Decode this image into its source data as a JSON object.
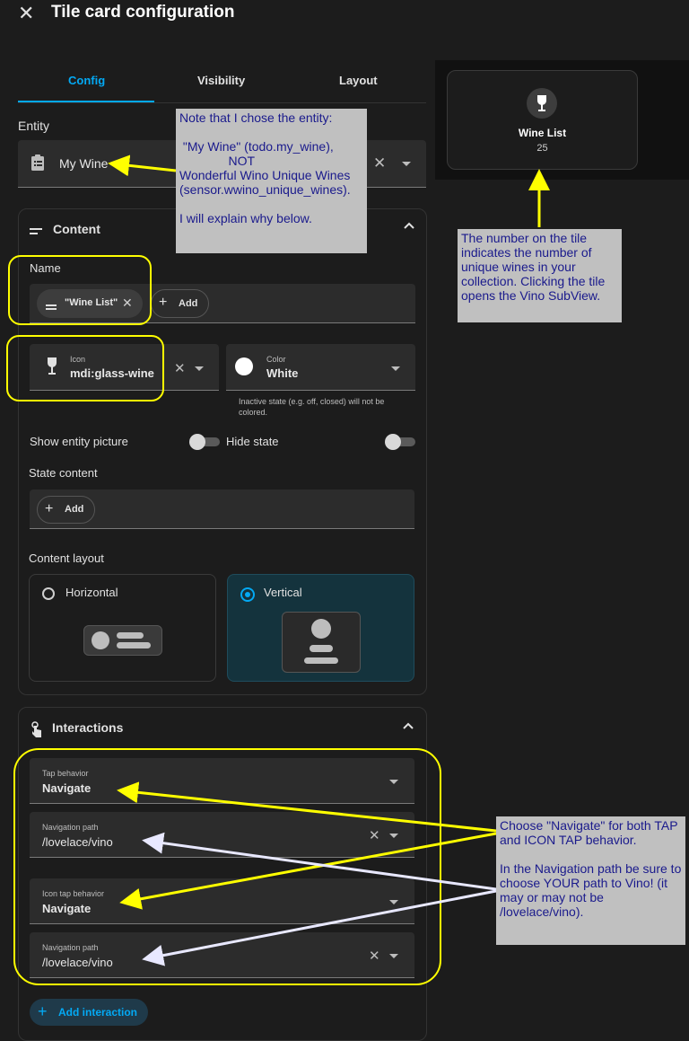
{
  "header": {
    "title": "Tile card configuration"
  },
  "tabs": [
    {
      "label": "Config"
    },
    {
      "label": "Visibility"
    },
    {
      "label": "Layout"
    }
  ],
  "entity": {
    "label": "Entity",
    "value": "My Wine"
  },
  "content": {
    "title": "Content",
    "name_label": "Name",
    "name_chip": "\"Wine List\"",
    "add_label": "Add",
    "icon_label": "Icon",
    "icon_value": "mdi:glass-wine",
    "color_label": "Color",
    "color_value": "White",
    "color_help": "Inactive state (e.g. off, closed) will not be colored.",
    "show_picture_label": "Show entity picture",
    "hide_state_label": "Hide state",
    "state_content_label": "State content",
    "state_add_label": "Add",
    "layout_label": "Content layout",
    "layout_horizontal": "Horizontal",
    "layout_vertical": "Vertical"
  },
  "interactions": {
    "title": "Interactions",
    "tap_label": "Tap behavior",
    "tap_value": "Navigate",
    "nav_label_1": "Navigation path",
    "nav_value_1": "/lovelace/vino",
    "icon_tap_label": "Icon tap behavior",
    "icon_tap_value": "Navigate",
    "nav_label_2": "Navigation path",
    "nav_value_2": "/lovelace/vino",
    "add_interaction": "Add interaction"
  },
  "preview": {
    "name": "Wine List",
    "state": "25"
  },
  "notes": {
    "entity_note": "Note that I chose the entity:\n\n \"My Wine\" (todo.my_wine),\n              NOT\nWonderful Wino Unique Wines\n(sensor.wwino_unique_wines).\n\nI will explain why below.",
    "tile_note": "The number on the tile indicates the number of unique wines in your collection. Clicking the tile opens the Vino SubView.",
    "interaction_note": "Choose \"Navigate\" for both TAP and ICON TAP behavior.\n\nIn the Navigation path be sure to choose YOUR path to Vino! (it may or may not be /lovelace/vino)."
  },
  "colors": {
    "accent": "#03a9f4",
    "annotation": "#ffff00",
    "note_bg": "#c0c0c0",
    "note_text": "#1a1a8c"
  }
}
